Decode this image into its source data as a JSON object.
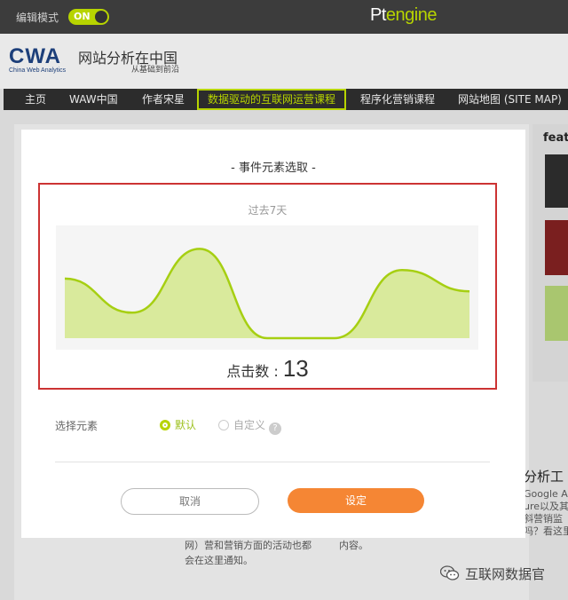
{
  "topbar": {
    "edit_mode_label": "编辑模式",
    "toggle_state": "ON",
    "brand_prefix": "Pt",
    "brand_suffix": "engine",
    "accent_color": "#b7d400"
  },
  "site": {
    "logo_text": "CWA",
    "logo_sub": "China Web Analytics",
    "title": "网站分析在中国",
    "slogan": "从基础到前沿"
  },
  "nav": {
    "items": [
      {
        "label": "主页"
      },
      {
        "label": "WAW中国"
      },
      {
        "label": "作者宋星"
      },
      {
        "label": "数据驱动的互联网运营课程",
        "active": true
      },
      {
        "label": "程序化营销课程"
      },
      {
        "label": "网站地图 (SITE MAP)"
      }
    ]
  },
  "background": {
    "feature_heading": "featu",
    "right_heading": "分析工",
    "right_lines": [
      "Google A",
      "ure以及其",
      "斜营销监",
      "吗？看这里！"
    ],
    "bottom_text_lines": [
      "网）营和营销方面的活动也都",
      "会在这里通知。"
    ],
    "bottom_text_2": "内容。",
    "watermark": "互联网数据官"
  },
  "modal": {
    "title": "- 事件元素选取 -",
    "period": "过去7天",
    "click_label": "点击数 : ",
    "click_value": "13",
    "select_label": "选择元素",
    "radio_default": "默认",
    "radio_custom": "自定义",
    "help_symbol": "?",
    "cancel_label": "取消",
    "confirm_label": "设定",
    "confirm_color": "#f58634",
    "highlight_color": "#cc3333"
  },
  "chart_data": {
    "type": "area",
    "x": [
      0,
      1,
      2,
      3,
      4,
      5,
      6
    ],
    "values": [
      2.8,
      1.2,
      4.2,
      0,
      0,
      3.2,
      2.2
    ],
    "ylim": [
      0,
      4.8
    ],
    "title": "",
    "xlabel": "",
    "ylabel": "",
    "grid": false,
    "line_color": "#a6cf12",
    "fill_color": "#d9ea9c"
  }
}
